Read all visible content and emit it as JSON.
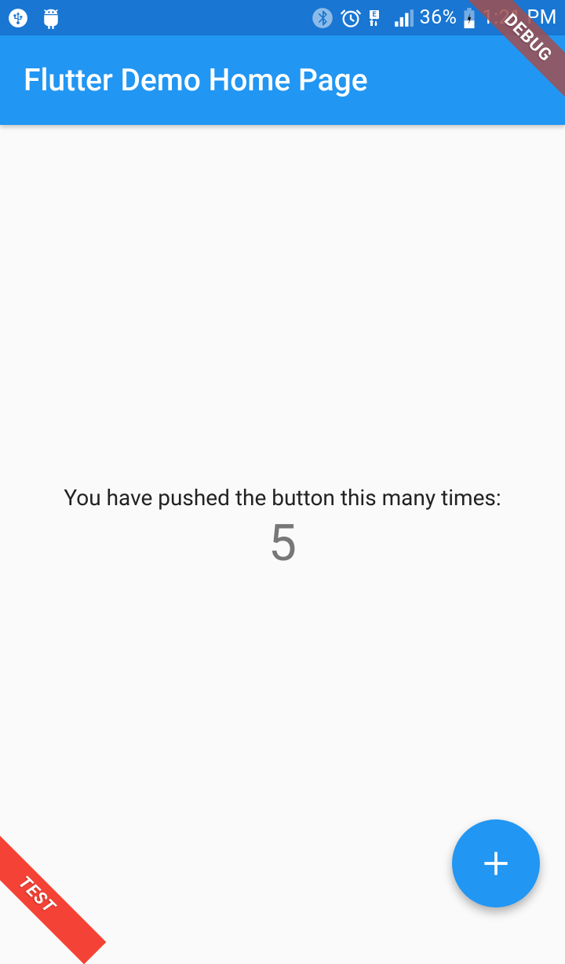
{
  "statusbar": {
    "battery_percent": "36%",
    "time": "1:21 PM"
  },
  "appbar": {
    "title": "Flutter Demo Home Page"
  },
  "content": {
    "counter_label": "You have pushed the button this many times:",
    "counter_value": "5"
  },
  "banners": {
    "debug": "DEBUG",
    "test": "TEST"
  }
}
